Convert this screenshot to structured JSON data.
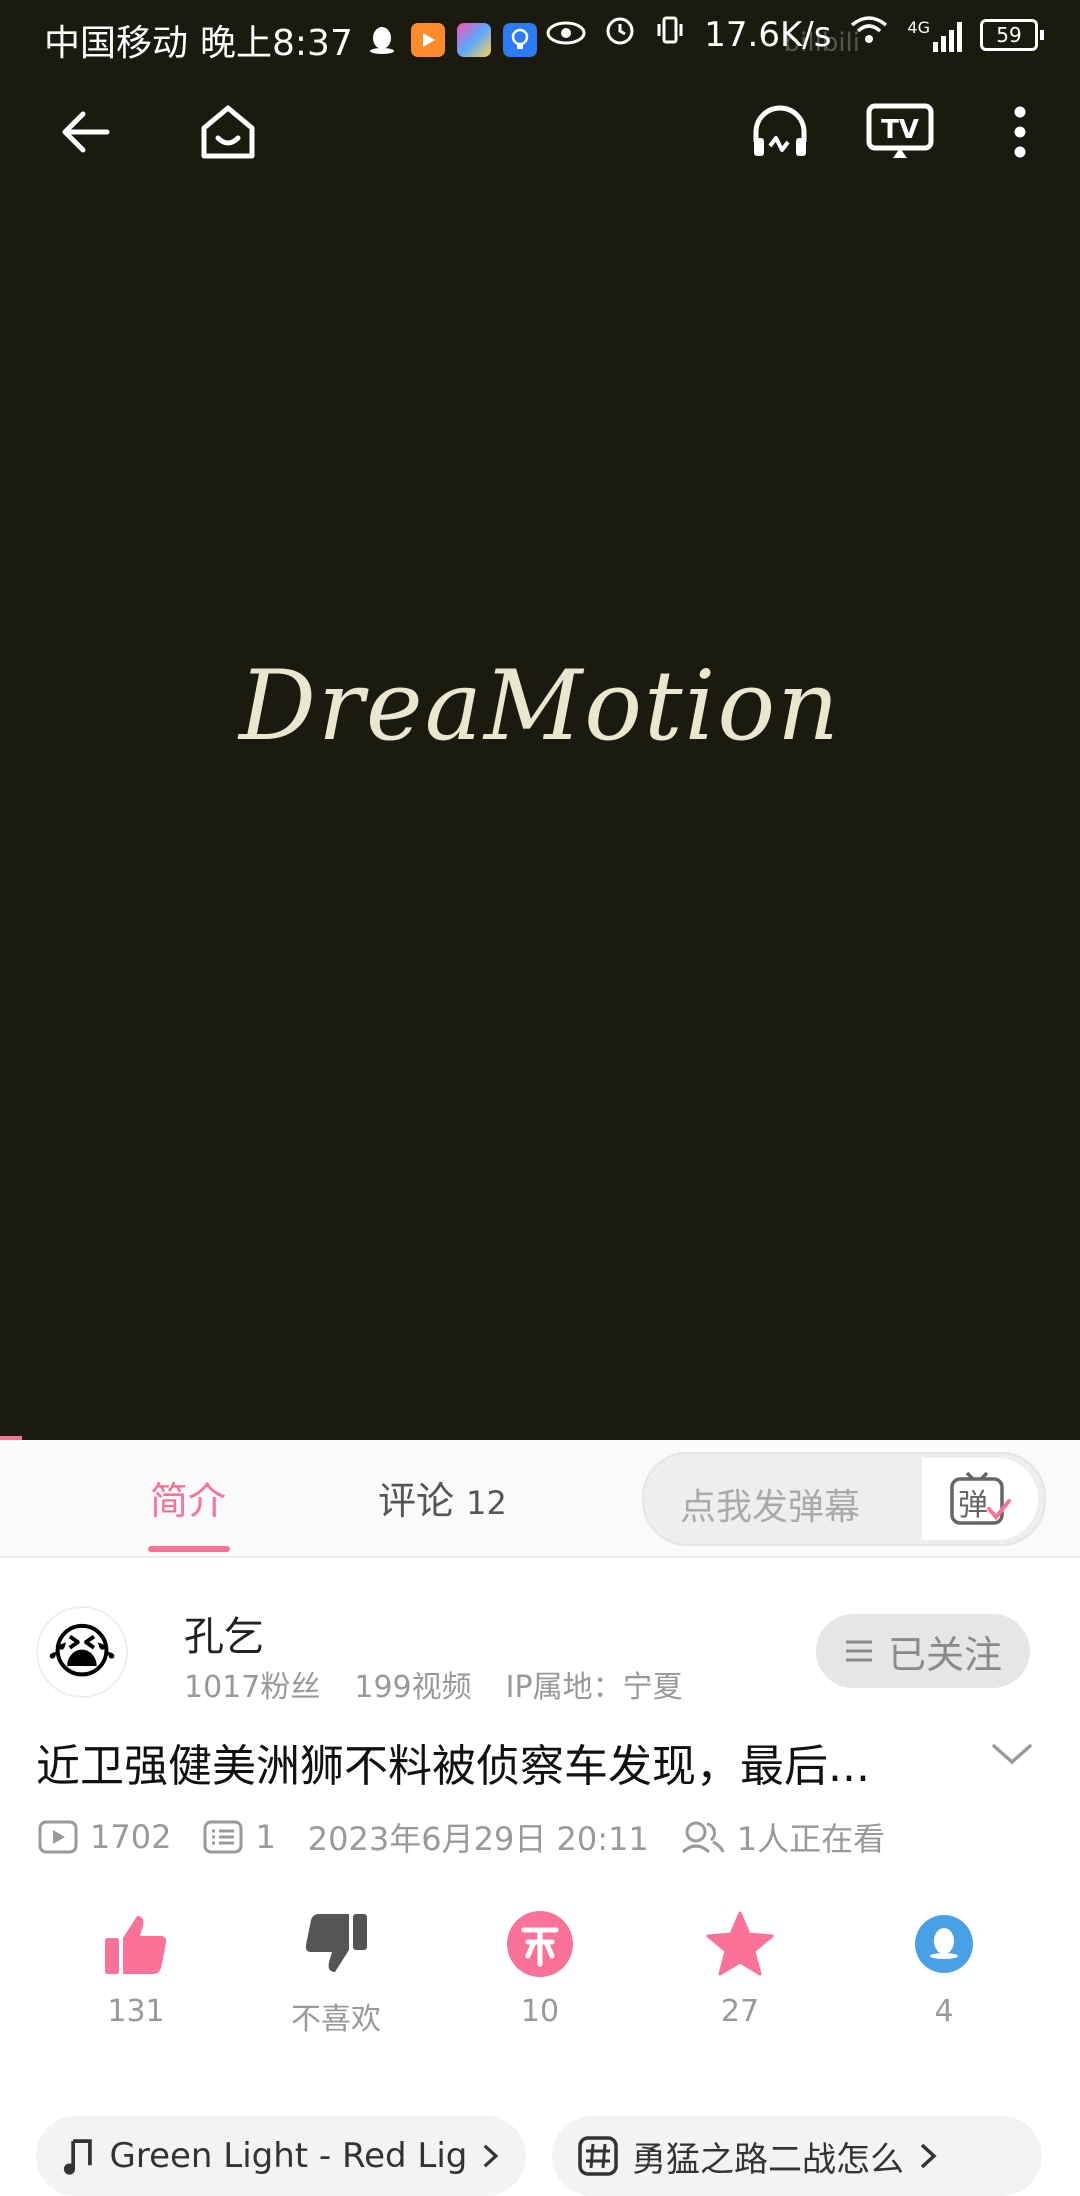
{
  "statusbar": {
    "carrier": "中国移动",
    "time": "晚上8:37",
    "speed": "17.6K/s",
    "network": "4G",
    "battery": "59"
  },
  "video": {
    "title_art": "DreaMotion",
    "watermark": "bilibili",
    "progress": 0.02
  },
  "tabs": {
    "intro": "简介",
    "comments_label": "评论",
    "comments_count": "12",
    "danmaku_placeholder": "点我发弹幕",
    "danmaku_button": "弹"
  },
  "uploader": {
    "name": "孔乞",
    "fans": "1017粉丝",
    "videos": "199视频",
    "ip": "IP属地：宁夏",
    "follow_label": "已关注",
    "avatar_emoji": "😭"
  },
  "video_info": {
    "title": "近卫强健美洲狮不料被侦察车发现，最后...",
    "plays": "1702",
    "danmaku_count": "1",
    "date": "2023年6月29日 20:11",
    "watching": "1人正在看"
  },
  "actions": [
    {
      "name": "like",
      "label": "131"
    },
    {
      "name": "dislike",
      "label": "不喜欢"
    },
    {
      "name": "coin",
      "label": "10"
    },
    {
      "name": "favorite",
      "label": "27"
    },
    {
      "name": "share-qq",
      "label": "4"
    }
  ],
  "chips": {
    "music": "Green Light - Red Lig",
    "topic": "勇猛之路二战怎么"
  },
  "colors": {
    "accent": "#fb7299",
    "video_bg": "#1b1a0f",
    "qq_blue": "#4aa0e6"
  }
}
